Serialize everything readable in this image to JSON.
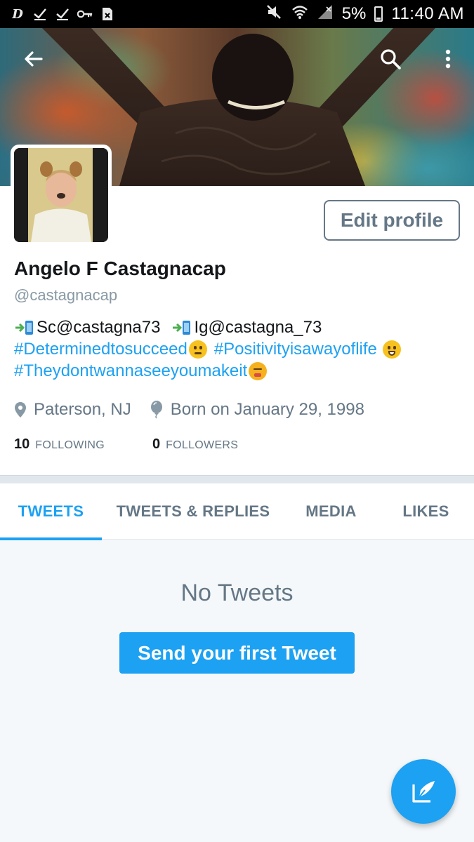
{
  "status_bar": {
    "app_letter": "D",
    "battery": "5%",
    "time": "11:40 AM",
    "icons": [
      "d-app-icon",
      "check-icon",
      "check-icon",
      "key-icon",
      "sim-icon",
      "mute-icon",
      "wifi-icon",
      "signal-icon",
      "battery-icon"
    ]
  },
  "header": {
    "back_icon": "arrow-left-icon",
    "search_icon": "search-icon",
    "more_icon": "more-vert-icon"
  },
  "profile": {
    "edit_button": "Edit profile",
    "name": "Angelo F Castagnacap",
    "handle": "@castagnacap",
    "bio": {
      "sc": "Sc@castagna73",
      "ig": "Ig@castagna_73",
      "tag1": "#Determinedtosucceed",
      "tag2": "#Positivityisawayoflife",
      "tag3": "#Theydontwannaseeyoumakeit"
    },
    "location": "Paterson, NJ",
    "birthday": "Born on January 29, 1998",
    "following_count": "10",
    "following_label": "FOLLOWING",
    "followers_count": "0",
    "followers_label": "FOLLOWERS"
  },
  "tabs": [
    "TWEETS",
    "TWEETS & REPLIES",
    "MEDIA",
    "LIKES"
  ],
  "active_tab": "TWEETS",
  "empty_state": {
    "title": "No Tweets",
    "cta": "Send your first Tweet"
  },
  "fab_icon": "compose-tweet-icon",
  "colors": {
    "accent": "#1da1f2",
    "secondary_text": "#657786",
    "status_bar": "#000000"
  }
}
